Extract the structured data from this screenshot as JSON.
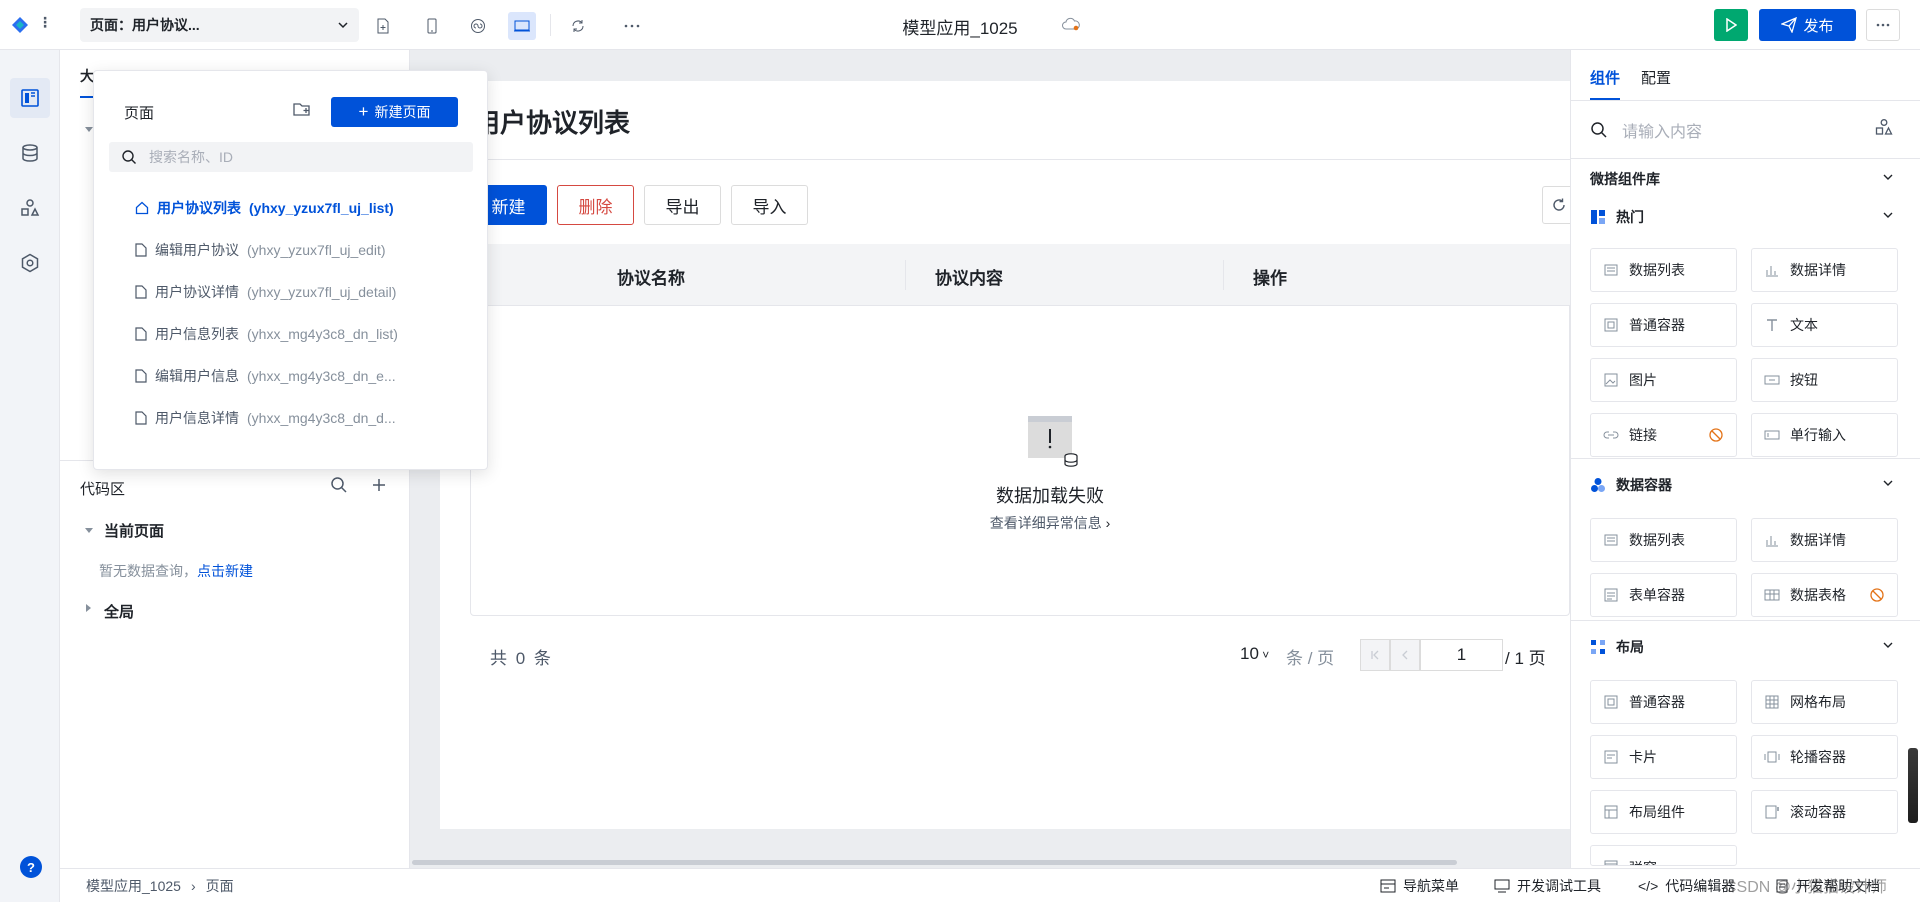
{
  "topbar": {
    "page_selector": "页面：用户协议...",
    "app_title": "模型应用_1025",
    "publish_label": "发布"
  },
  "left_panel": {
    "tab_label": "大",
    "code_area_title": "代码区",
    "current_page_label": "当前页面",
    "no_data_text": "暂无数据查询，",
    "create_link": "点击新建",
    "global_label": "全局"
  },
  "popover": {
    "title": "页面",
    "new_page_button": "新建页面",
    "search_placeholder": "搜索名称、ID",
    "pages": [
      {
        "name": "用户协议列表",
        "id": "(yhxy_yzux7fl_uj_list)",
        "icon": "home-icon",
        "active": true
      },
      {
        "name": "编辑用户协议",
        "id": "(yhxy_yzux7fl_uj_edit)",
        "icon": "file-icon",
        "active": false
      },
      {
        "name": "用户协议详情",
        "id": "(yhxy_yzux7fl_uj_detail)",
        "icon": "file-icon",
        "active": false
      },
      {
        "name": "用户信息列表",
        "id": "(yhxx_mg4y3c8_dn_list)",
        "icon": "file-icon",
        "active": false
      },
      {
        "name": "编辑用户信息",
        "id": "(yhxx_mg4y3c8_dn_e...",
        "icon": "file-icon",
        "active": false
      },
      {
        "name": "用户信息详情",
        "id": "(yhxx_mg4y3c8_dn_d...",
        "icon": "file-icon",
        "active": false
      }
    ]
  },
  "canvas": {
    "page_title": "用户协议列表",
    "buttons": {
      "new": "新建",
      "delete": "删除",
      "export": "导出",
      "import": "导入"
    },
    "columns": [
      "协议名称",
      "协议内容",
      "操作"
    ],
    "empty_title": "数据加载失败",
    "empty_link": "查看详细异常信息",
    "total_text": "共 0 条",
    "page_size": "10",
    "page_unit": "条 / 页",
    "current_page": "1",
    "total_pages": "/ 1 页"
  },
  "right_panel": {
    "tabs": [
      "组件",
      "配置"
    ],
    "search_placeholder": "请输入内容",
    "library_title": "微搭组件库",
    "sections": [
      {
        "title": "热门",
        "items": [
          "数据列表",
          "数据详情",
          "普通容器",
          "文本",
          "图片",
          "按钮",
          "链接",
          "单行输入"
        ]
      },
      {
        "title": "数据容器",
        "items": [
          "数据列表",
          "数据详情",
          "表单容器",
          "数据表格"
        ]
      },
      {
        "title": "布局",
        "items": [
          "普通容器",
          "网格布局",
          "卡片",
          "轮播容器",
          "布局组件",
          "滚动容器",
          "弹窗"
        ]
      }
    ]
  },
  "statusbar": {
    "breadcrumb": [
      "模型应用_1025",
      "页面"
    ],
    "nav_menu": "导航菜单",
    "dev_tools": "开发调试工具",
    "code_editor": "代码编辑器",
    "dev_docs": "开发帮助文档",
    "watermark": "CSDN @小猫猫设计师"
  },
  "colors": {
    "primary": "#0052d9",
    "danger": "#d54941",
    "success": "#00a870"
  }
}
